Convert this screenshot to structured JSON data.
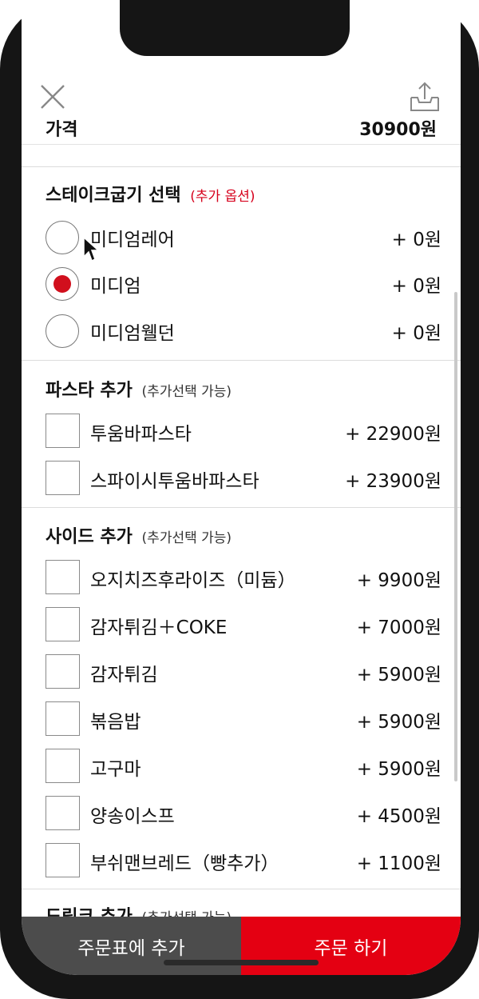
{
  "price": {
    "label": "가격",
    "value": "30900원"
  },
  "steak": {
    "title": "스테이크굽기 선택",
    "hint": "(추가 옵션)",
    "options": [
      {
        "name": "미디엄레어",
        "price": "+ 0원",
        "selected": false
      },
      {
        "name": "미디엄",
        "price": "+ 0원",
        "selected": true
      },
      {
        "name": "미디엄웰던",
        "price": "+ 0원",
        "selected": false
      }
    ]
  },
  "pasta": {
    "title": "파스타 추가",
    "hint": "(추가선택 가능)",
    "items": [
      {
        "name": "투움바파스타",
        "price": "+ 22900원"
      },
      {
        "name": "스파이시투움바파스타",
        "price": "+ 23900원"
      }
    ]
  },
  "side": {
    "title": "사이드 추가",
    "hint": "(추가선택 가능)",
    "items": [
      {
        "name": "오지치즈후라이즈（미듐）",
        "price": "+ 9900원"
      },
      {
        "name": "감자튀김＋COKE",
        "price": "+ 7000원"
      },
      {
        "name": "감자튀김",
        "price": "+ 5900원"
      },
      {
        "name": "볶음밥",
        "price": "+ 5900원"
      },
      {
        "name": "고구마",
        "price": "+ 5900원"
      },
      {
        "name": "양송이스프",
        "price": "+ 4500원"
      },
      {
        "name": "부쉬맨브레드（빵추가）",
        "price": "+ 1100원"
      }
    ]
  },
  "drink": {
    "title": "드링크 추가",
    "hint": "(추가선택 가능)"
  },
  "buttons": {
    "add_to_cart": "주문표에 추가",
    "order": "주문 하기"
  },
  "colors": {
    "accent": "#e40012",
    "selected_dot": "#d10f1d",
    "cart_button": "#4c4c4c"
  },
  "icons": {
    "close": "close-icon",
    "share": "share-icon"
  }
}
